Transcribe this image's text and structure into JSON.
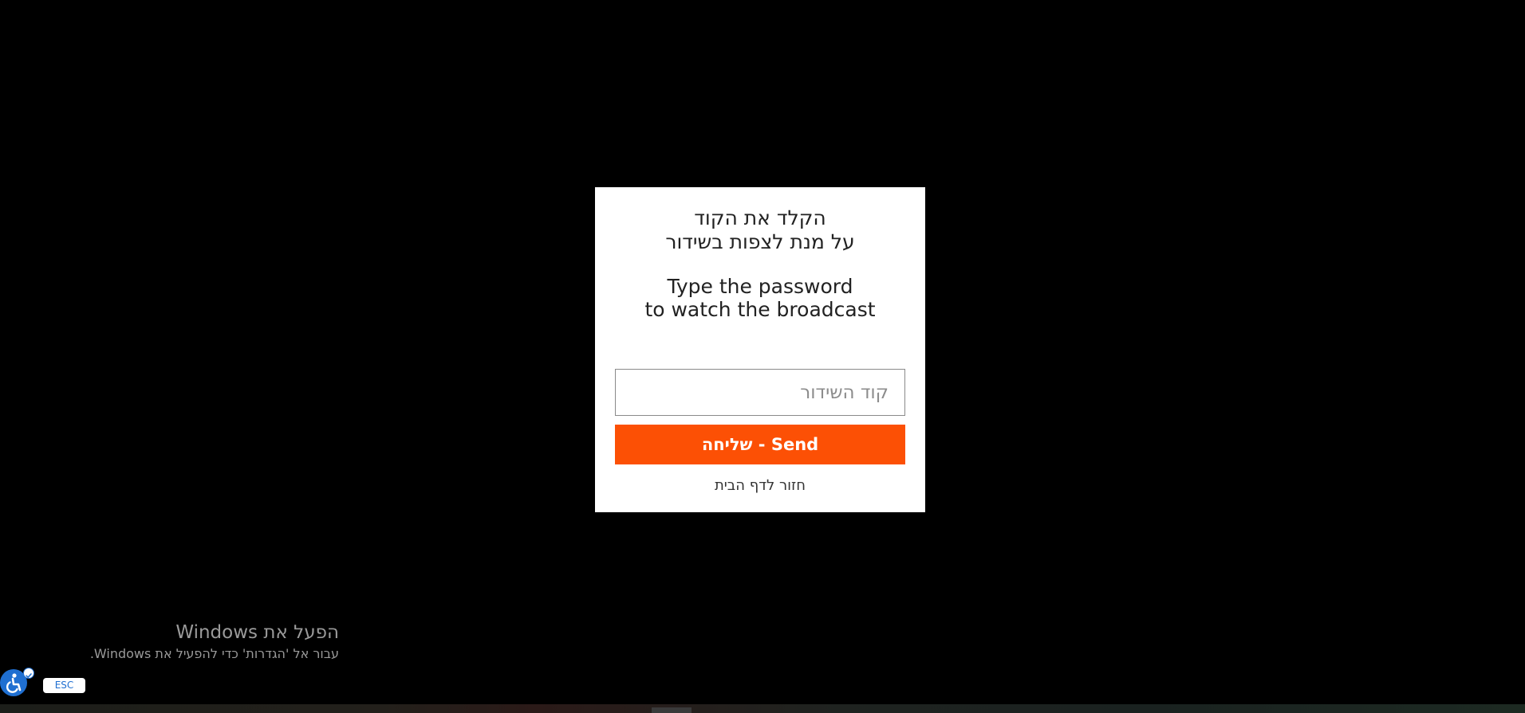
{
  "modal": {
    "heading_he_line1": "הקלד את הקוד",
    "heading_he_line2": "על מנת לצפות בשידור",
    "heading_en_line1": "Type the password",
    "heading_en_line2": "to watch the broadcast",
    "code_input": {
      "placeholder": "קוד השידור",
      "value": ""
    },
    "send_button_label": "שליחה - Send",
    "home_link_label": "חזור לדף הבית"
  },
  "windows_activation": {
    "title": "הפעל את Windows",
    "subtitle": "עבור אל 'הגדרות' כדי להפעיל את Windows."
  },
  "accessibility": {
    "icon": "accessibility-icon",
    "esc_label": "ESC"
  },
  "colors": {
    "background": "#000000",
    "modal_background": "#ffffff",
    "accent": "#fc5005",
    "accessibility_blue": "#1f6fd1"
  }
}
